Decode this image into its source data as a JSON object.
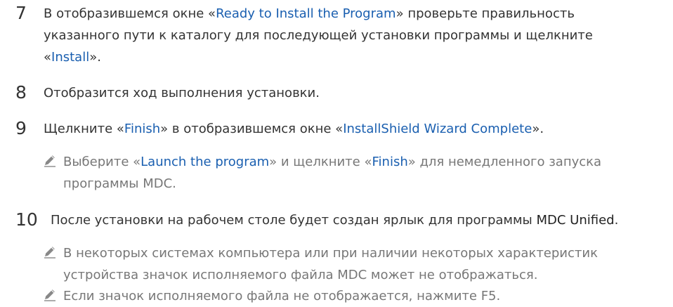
{
  "steps": [
    {
      "number": "7",
      "line1_a": "В отобразившемся окне «",
      "line1_link": "Ready to Install the Program",
      "line1_b": "» проверьте правильность",
      "line2": "указанного пути к каталогу для последующей установки программы и щелкните",
      "line3_a": "«",
      "line3_link": "Install",
      "line3_b": "»."
    },
    {
      "number": "8",
      "text": "Отобразится ход выполнения установки."
    },
    {
      "number": "9",
      "text_a": "Щелкните «",
      "link1": "Finish",
      "text_b": "» в отобразившемся окне «",
      "link2": "InstallShield Wizard Complete",
      "text_c": "».",
      "note": {
        "icon": "pencil-icon",
        "a": "Выберите «",
        "link1": "Launch the program",
        "b": "» и щелкните «",
        "link2": "Finish",
        "c": "» для немедленного запуска",
        "line2": "программы MDC."
      }
    },
    {
      "number": "10",
      "text_a": "После установки на рабочем столе будет создан ярлык для программы ",
      "strong": "MDC Unified",
      "text_b": ".",
      "notes": [
        {
          "icon": "pencil-icon",
          "line1": "В некоторых системах компьютера или при наличии некоторых характеристик",
          "line2": "устройства значок исполняемого файла MDC может не отображаться."
        },
        {
          "icon": "pencil-icon",
          "line1": "Если значок исполняемого файла не отображается, нажмите F5."
        }
      ]
    }
  ],
  "colors": {
    "text": "#333333",
    "link": "#1a5fb0",
    "note_text": "#777777",
    "icon": "#888888"
  }
}
